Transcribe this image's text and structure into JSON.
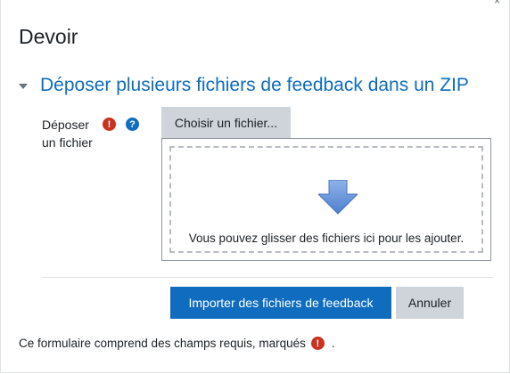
{
  "window": {
    "close_glyph": "×"
  },
  "page": {
    "title": "Devoir"
  },
  "section": {
    "title": "Déposer plusieurs fichiers de feedback dans un ZIP"
  },
  "upload": {
    "label_line1": "Déposer",
    "label_line2": "un fichier",
    "required_icon": "exclamation-circle-icon",
    "help_icon": "question-circle-icon",
    "choose_label": "Choisir un fichier...",
    "drop_text": "Vous pouvez glisser des fichiers ici pour les ajouter."
  },
  "actions": {
    "import_label": "Importer des fichiers de feedback",
    "cancel_label": "Annuler"
  },
  "footer": {
    "note_before": "Ce formulaire comprend des champs requis, marqués",
    "note_after": "."
  },
  "colors": {
    "accent": "#0f6cbf",
    "required": "#ca3120",
    "secondary_button": "#ced4da",
    "arrow": "#6b96d8"
  }
}
